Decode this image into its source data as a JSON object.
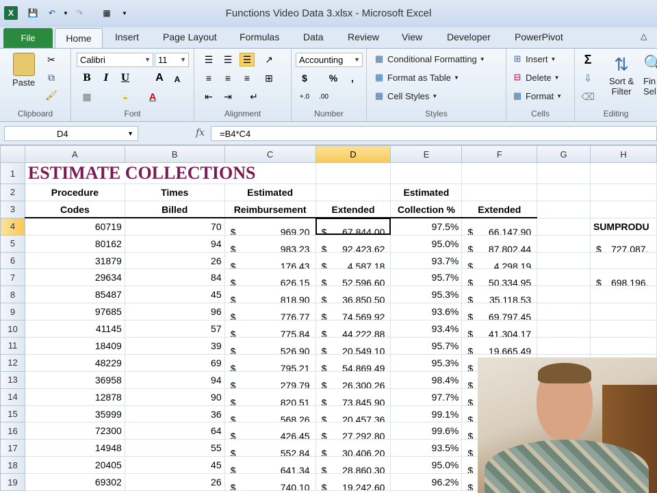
{
  "window": {
    "title": "Functions Video Data 3.xlsx - Microsoft Excel"
  },
  "quick_access": {
    "app_icon": "excel-logo-icon",
    "items": [
      "save-icon",
      "undo-icon",
      "redo-icon",
      "print-preview-icon",
      "customize-icon"
    ]
  },
  "ribbon_tabs": [
    "File",
    "Home",
    "Insert",
    "Page Layout",
    "Formulas",
    "Data",
    "Review",
    "View",
    "Developer",
    "PowerPivot"
  ],
  "ribbon": {
    "clipboard": {
      "label": "Clipboard",
      "paste": "Paste"
    },
    "font": {
      "label": "Font",
      "name": "Calibri",
      "size": "11",
      "bold": "B",
      "italic": "I",
      "underline": "U",
      "grow": "A",
      "shrink": "A"
    },
    "alignment": {
      "label": "Alignment"
    },
    "number": {
      "label": "Number",
      "format": "Accounting",
      "currency": "$",
      "percent": "%",
      "comma": ","
    },
    "styles": {
      "label": "Styles",
      "conditional": "Conditional Formatting",
      "format_table": "Format as Table",
      "cell_styles": "Cell Styles"
    },
    "cells": {
      "label": "Cells",
      "insert": "Insert",
      "delete": "Delete",
      "format": "Format"
    },
    "editing": {
      "label": "Editing",
      "sigma": "Σ",
      "sort1": "Sort &",
      "sort2": "Filter",
      "find1": "Fin",
      "find2": "Sel"
    }
  },
  "formula_bar": {
    "name_box": "D4",
    "fx": "fx",
    "formula": "=B4*C4"
  },
  "columns": [
    "A",
    "B",
    "C",
    "D",
    "E",
    "F",
    "G",
    "H"
  ],
  "selected": {
    "column": "D",
    "row": "4"
  },
  "sheet": {
    "title": "ESTIMATE COLLECTIONS",
    "header_row2": {
      "A": "Procedure",
      "B": "Times",
      "C": "Estimated",
      "E": "Estimated"
    },
    "header_row3": {
      "A": "Codes",
      "B": "Billed",
      "C": "Reimbursement",
      "D": "Extended",
      "E": "Collection %",
      "F": "Extended"
    },
    "side_label": "SUMPRODU",
    "side_values": {
      "row5": "727,087.",
      "row7": "698,196."
    },
    "currency_symbol": "$",
    "rows": [
      {
        "n": "4",
        "code": "60719",
        "billed": "70",
        "reimb": "969.20",
        "ext": "67,844.00",
        "pct": "97.5%",
        "ext2": "66,147.90"
      },
      {
        "n": "5",
        "code": "80162",
        "billed": "94",
        "reimb": "983.23",
        "ext": "92,423.62",
        "pct": "95.0%",
        "ext2": "87,802.44"
      },
      {
        "n": "6",
        "code": "31879",
        "billed": "26",
        "reimb": "176.43",
        "ext": "4,587.18",
        "pct": "93.7%",
        "ext2": "4,298.19"
      },
      {
        "n": "7",
        "code": "29634",
        "billed": "84",
        "reimb": "626.15",
        "ext": "52,596.60",
        "pct": "95.7%",
        "ext2": "50,334.95"
      },
      {
        "n": "8",
        "code": "85487",
        "billed": "45",
        "reimb": "818.90",
        "ext": "36,850.50",
        "pct": "95.3%",
        "ext2": "35,118.53"
      },
      {
        "n": "9",
        "code": "97685",
        "billed": "96",
        "reimb": "776.77",
        "ext": "74,569.92",
        "pct": "93.6%",
        "ext2": "69,797.45"
      },
      {
        "n": "10",
        "code": "41145",
        "billed": "57",
        "reimb": "775.84",
        "ext": "44,222.88",
        "pct": "93.4%",
        "ext2": "41,304.17"
      },
      {
        "n": "11",
        "code": "18409",
        "billed": "39",
        "reimb": "526.90",
        "ext": "20,549.10",
        "pct": "95.7%",
        "ext2": "19,665.49"
      },
      {
        "n": "12",
        "code": "48229",
        "billed": "69",
        "reimb": "795.21",
        "ext": "54,869.49",
        "pct": "95.3%",
        "ext2": ""
      },
      {
        "n": "13",
        "code": "36958",
        "billed": "94",
        "reimb": "279.79",
        "ext": "26,300.26",
        "pct": "98.4%",
        "ext2": ""
      },
      {
        "n": "14",
        "code": "12878",
        "billed": "90",
        "reimb": "820.51",
        "ext": "73,845.90",
        "pct": "97.7%",
        "ext2": ""
      },
      {
        "n": "15",
        "code": "35999",
        "billed": "36",
        "reimb": "568.26",
        "ext": "20,457.36",
        "pct": "99.1%",
        "ext2": ""
      },
      {
        "n": "16",
        "code": "72300",
        "billed": "64",
        "reimb": "426.45",
        "ext": "27,292.80",
        "pct": "99.6%",
        "ext2": ""
      },
      {
        "n": "17",
        "code": "14948",
        "billed": "55",
        "reimb": "552.84",
        "ext": "30,406.20",
        "pct": "93.5%",
        "ext2": ""
      },
      {
        "n": "18",
        "code": "20405",
        "billed": "45",
        "reimb": "641.34",
        "ext": "28,860.30",
        "pct": "95.0%",
        "ext2": ""
      },
      {
        "n": "19",
        "code": "69302",
        "billed": "26",
        "reimb": "740.10",
        "ext": "19,242.60",
        "pct": "96.2%",
        "ext2": ""
      }
    ]
  },
  "colors": {
    "title": "#7a1a55",
    "file_tab": "#2a8a3e",
    "selection": "#f8c955"
  }
}
